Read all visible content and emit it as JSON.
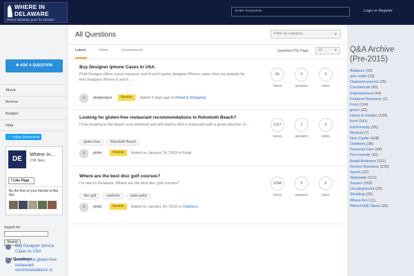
{
  "brand": {
    "name_line1": "WHERE IN",
    "name_line2": "DELAWARE",
    "tagline": "Where Delaware goes for answers"
  },
  "header": {
    "search_placeholder": "Enter Keywords",
    "login": "Login",
    "or": "or",
    "register": "Register"
  },
  "sidebar": {
    "ask_button": "ASK A QUESTION",
    "nav": [
      "About",
      "Archive",
      "Badges",
      "Help"
    ],
    "follow": "Follow @whereinde",
    "facebook": {
      "thumb": "DE",
      "name": "Where In...",
      "likes": "2.5K likes",
      "like_button": "Like Page",
      "friends_text": "Be the first of your friends to like this"
    },
    "search_label": "Search for:",
    "search_button": "Search",
    "hot_title": "Hot Questions",
    "hot": [
      "Buy Designer Iphone Cases In USA",
      "Looking for gluten-free restaurant recommendations in"
    ]
  },
  "main": {
    "title": "All Questions",
    "filter_placeholder": "Filter by category",
    "tabs": [
      "Latest",
      "Votes",
      "Unanswered"
    ],
    "per_page_label": "Questions Per Page:",
    "per_page_value": "10",
    "stat_labels": {
      "views": "views",
      "answers": "answers",
      "votes": "votes"
    },
    "questions": [
      {
        "title": "Buy Designer Iphone Cases In USA",
        "excerpt": "PLIA Designs offers cutest macaron and French pastry designer iPhone cases.Visit our website for find cheapest iPhone 6 and 6 ...",
        "tags": [],
        "author": "pliadesigns",
        "badge": "Newbie",
        "asked": "Asked 6 days ago in",
        "category": "Retail & Shopping",
        "views": "65",
        "answers": "0",
        "votes": "0"
      },
      {
        "title": "Looking for gluten-free restaurant recommendations in Rehoboth Beach?",
        "excerpt": "I'll be heading to the beach next weekend and will need to find a restaurant with a good selection of ...",
        "tags": [
          "gluten-free",
          "Rehoboth Beach"
        ],
        "author": "philw",
        "badge": "Newbie",
        "asked": "Asked on January 24, 2015 in",
        "category": "Food",
        "views": "1157",
        "answers": "1",
        "votes": "0"
      },
      {
        "title": "Where are the best disc golf courses?",
        "excerpt": "I'm new to Delaware. Where are the best disc golf courses?",
        "tags": [
          "disc golf",
          "outdoors",
          "state parks"
        ],
        "author": "philw",
        "badge": "Newbie",
        "asked": "Asked on January 24, 2015 in",
        "category": "Outdoors",
        "views": "1058",
        "answers": "0",
        "votes": "0"
      }
    ]
  },
  "archive": {
    "title": "Q&A Archive (Pre-2015)",
    "items": [
      {
        "name": "Antiques",
        "count": "(15)"
      },
      {
        "name": "arts-crafts",
        "count": "(19)"
      },
      {
        "name": "Classes/Lessons",
        "count": "(25)"
      },
      {
        "name": "Commercial",
        "count": "(43)"
      },
      {
        "name": "Entertainment",
        "count": "(44)"
      },
      {
        "name": "Featured Business",
        "count": "(2)"
      },
      {
        "name": "Food",
        "count": "(114)"
      },
      {
        "name": "green",
        "count": "(22)"
      },
      {
        "name": "Home & Garden",
        "count": "(134)"
      },
      {
        "name": "Kent",
        "count": "(141)"
      },
      {
        "name": "Kid-Friendly",
        "count": "(26)"
      },
      {
        "name": "Medical",
        "count": "(7)"
      },
      {
        "name": "New Castle",
        "count": "(428)"
      },
      {
        "name": "Outdoors",
        "count": "(38)"
      },
      {
        "name": "Personal Care",
        "count": "(49)"
      },
      {
        "name": "Pet-Friendly",
        "count": "(16)"
      },
      {
        "name": "Retail Business",
        "count": "(151)"
      },
      {
        "name": "Service Business",
        "count": "(239)"
      },
      {
        "name": "Sports",
        "count": "(22)"
      },
      {
        "name": "Statewide",
        "count": "(121)"
      },
      {
        "name": "Sussex",
        "count": "(153)"
      },
      {
        "name": "Uncategorized",
        "count": "(29)"
      },
      {
        "name": "Wedding",
        "count": "(20)"
      },
      {
        "name": "Where Am I",
        "count": "(1)"
      },
      {
        "name": "WhereInDE News",
        "count": "(20)"
      }
    ]
  },
  "colors": {
    "header_bg": "#101b3b",
    "accent": "#2b8fd9",
    "tab_active": "#f0a01a",
    "badge": "#f7d848",
    "link": "#2b6cc4"
  }
}
